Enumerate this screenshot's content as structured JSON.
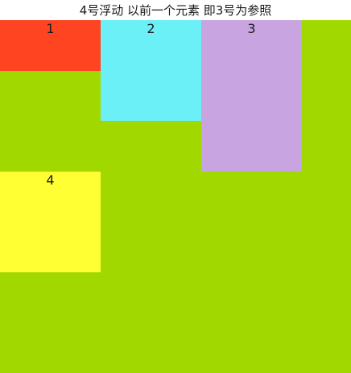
{
  "caption": "4号浮动 以前一个元素 即3号为参照",
  "boxes": [
    {
      "label": "1",
      "color": "#ff4422"
    },
    {
      "label": "2",
      "color": "#6cf0f8"
    },
    {
      "label": "3",
      "color": "#c8a4e0"
    },
    {
      "label": "4",
      "color": "#ffff33"
    }
  ],
  "container_color": "#a0d800"
}
